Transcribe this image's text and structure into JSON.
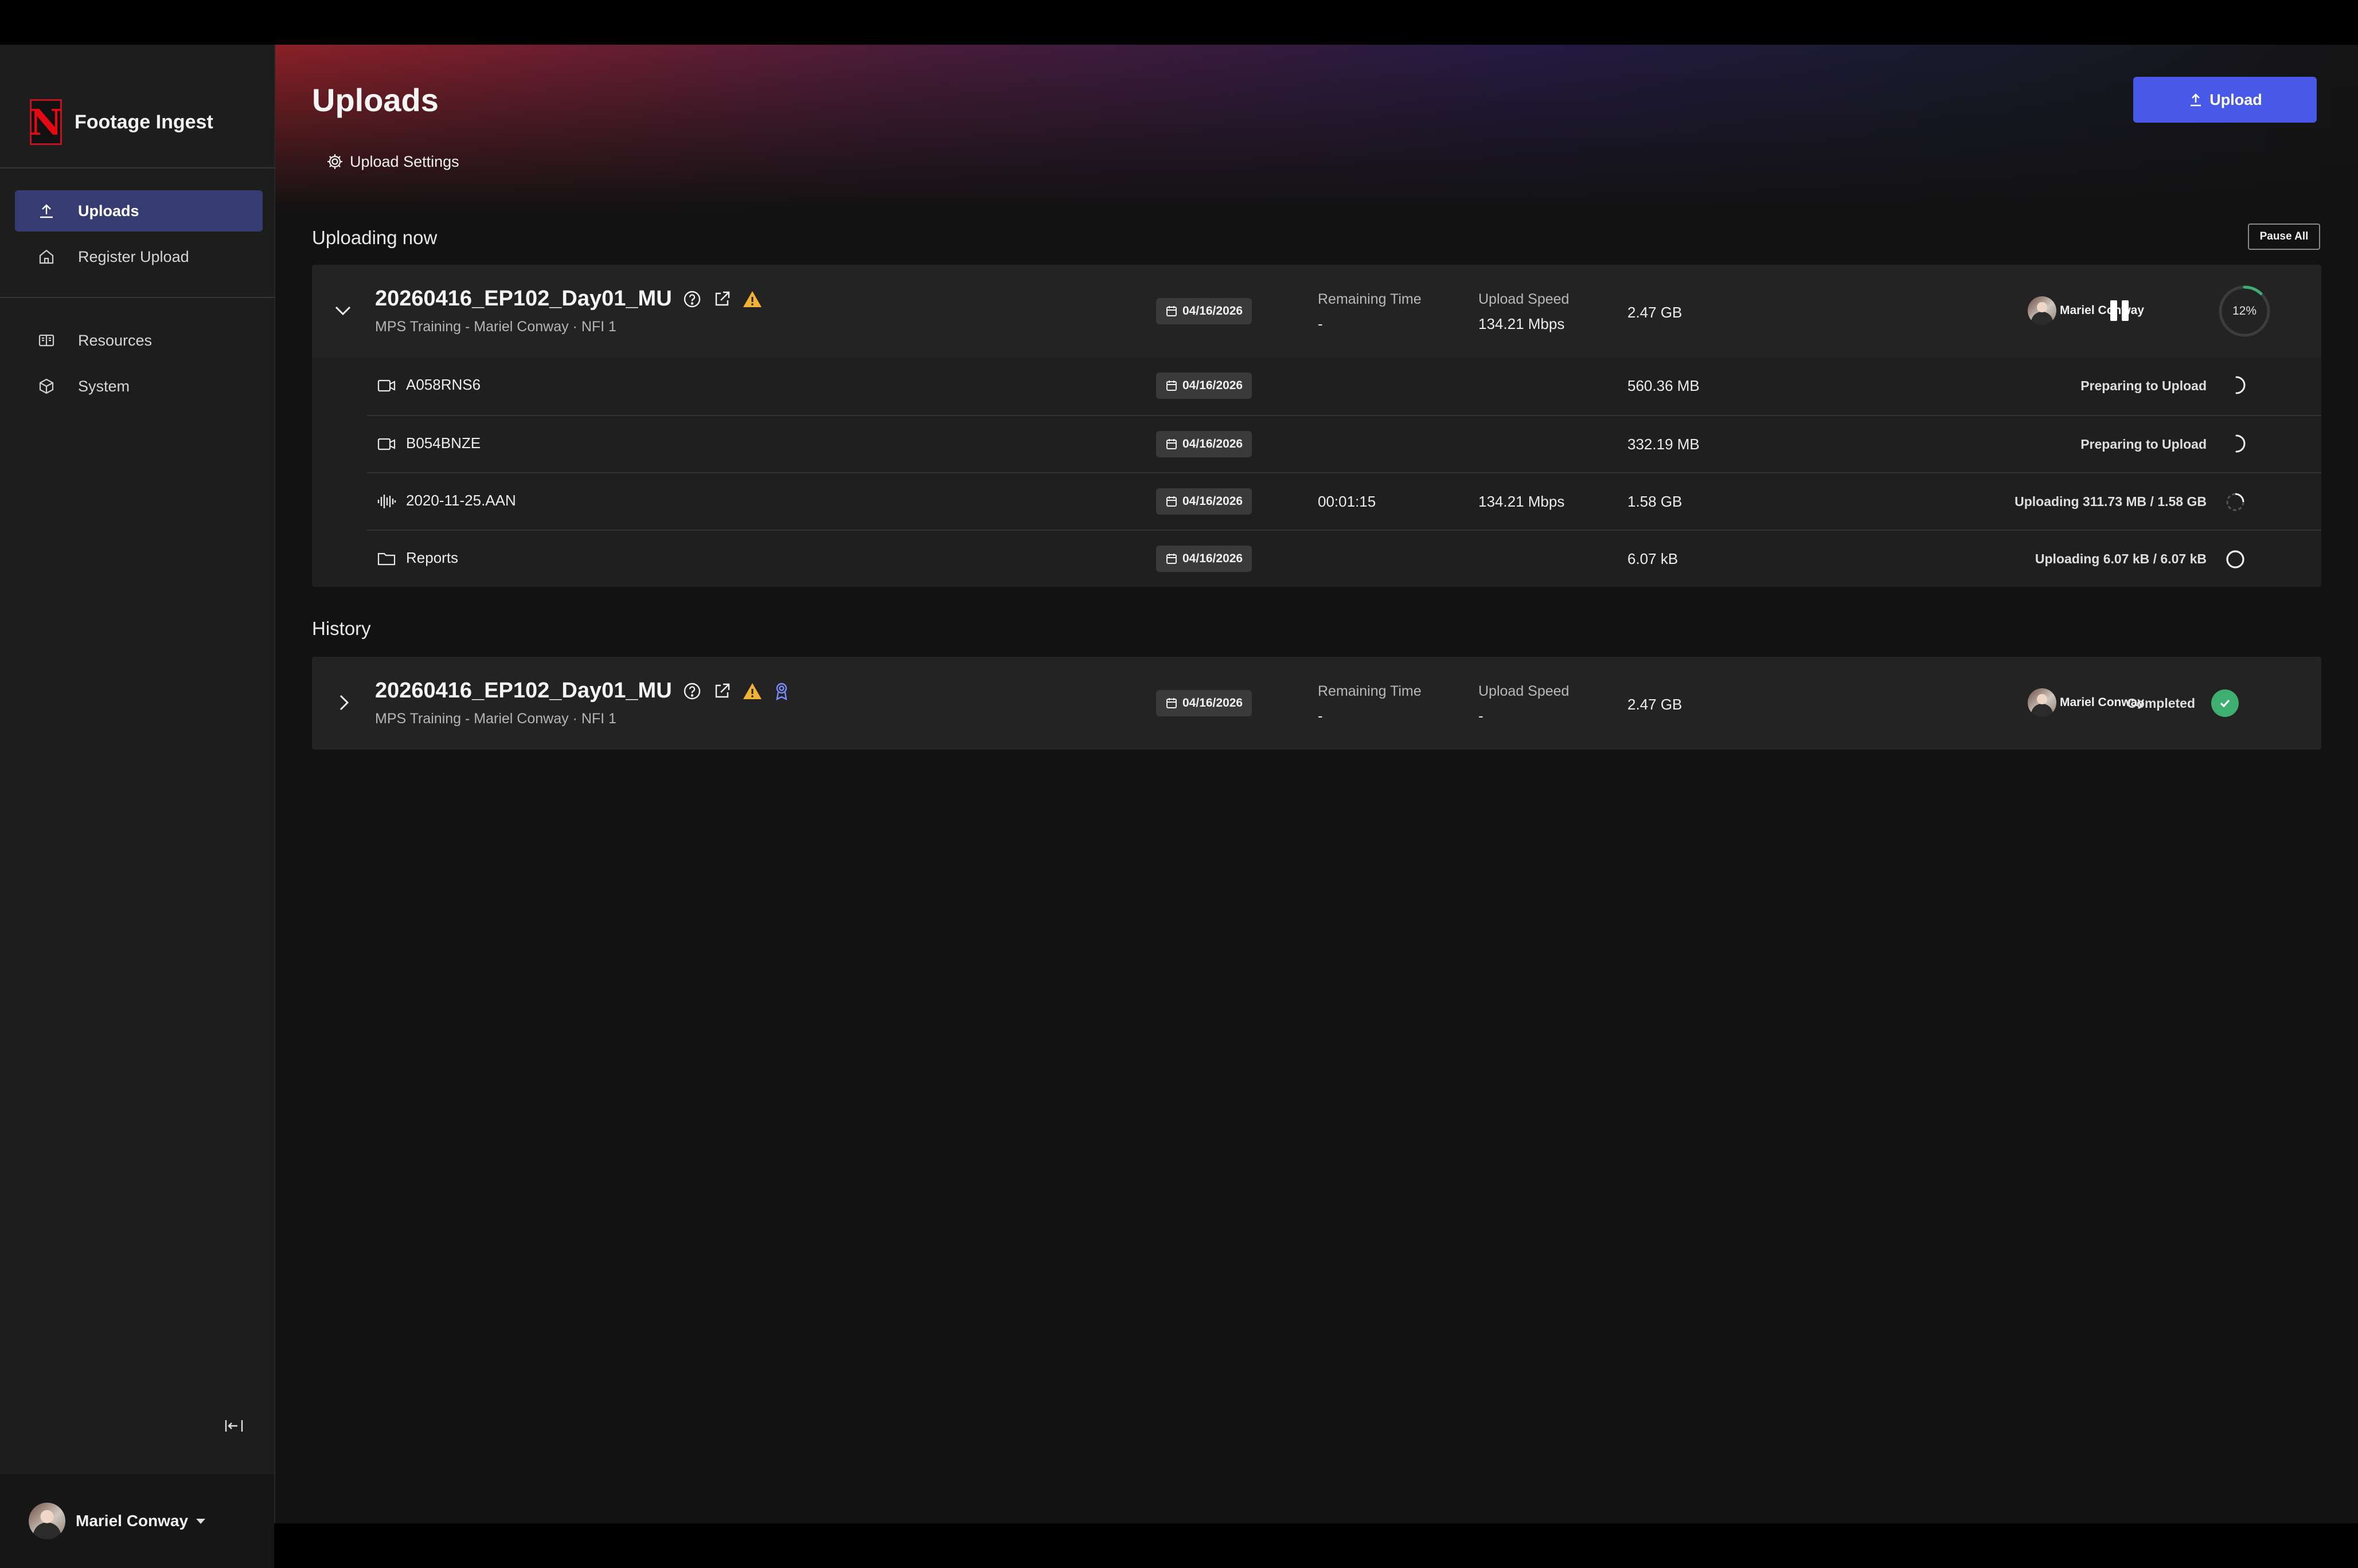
{
  "app": {
    "title": "Footage Ingest"
  },
  "sidebar": {
    "nav": [
      {
        "label": "Uploads",
        "icon": "upload-icon",
        "active": true
      },
      {
        "label": "Register Upload",
        "icon": "home-icon",
        "active": false
      }
    ],
    "nav2": [
      {
        "label": "Resources",
        "icon": "book-icon"
      },
      {
        "label": "System",
        "icon": "cube-icon"
      }
    ],
    "user": {
      "name": "Mariel Conway"
    }
  },
  "header": {
    "title": "Uploads",
    "upload_button": "Upload",
    "settings_link": "Upload Settings"
  },
  "uploading": {
    "section_title": "Uploading now",
    "pause_all": "Pause All",
    "group": {
      "name": "20260416_EP102_Day01_MU",
      "subtitle": "MPS Training - Mariel Conway · NFI 1",
      "date": "04/16/2026",
      "remaining_label": "Remaining Time",
      "remaining_value": "-",
      "speed_label": "Upload Speed",
      "speed_value": "134.21 Mbps",
      "size": "2.47 GB",
      "owner": "Mariel Conway",
      "progress_percent": 12,
      "progress_text": "12%"
    },
    "files": [
      {
        "name": "A058RNS6",
        "icon": "video-camera-icon",
        "date": "04/16/2026",
        "remaining": "",
        "speed": "",
        "size": "560.36 MB",
        "status": "Preparing to Upload",
        "state": "preparing"
      },
      {
        "name": "B054BNZE",
        "icon": "video-camera-icon",
        "date": "04/16/2026",
        "remaining": "",
        "speed": "",
        "size": "332.19 MB",
        "status": "Preparing to Upload",
        "state": "preparing"
      },
      {
        "name": "2020-11-25.AAN",
        "icon": "audio-waveform-icon",
        "date": "04/16/2026",
        "remaining": "00:01:15",
        "speed": "134.21 Mbps",
        "size": "1.58 GB",
        "status": "Uploading 311.73 MB / 1.58 GB",
        "state": "uploading"
      },
      {
        "name": "Reports",
        "icon": "folder-icon",
        "date": "04/16/2026",
        "remaining": "",
        "speed": "",
        "size": "6.07 kB",
        "status": "Uploading 6.07 kB / 6.07 kB",
        "state": "done-ring"
      }
    ]
  },
  "history": {
    "section_title": "History",
    "group": {
      "name": "20260416_EP102_Day01_MU",
      "subtitle": "MPS Training - Mariel Conway · NFI 1",
      "date": "04/16/2026",
      "remaining_label": "Remaining Time",
      "remaining_value": "-",
      "speed_label": "Upload Speed",
      "speed_value": "-",
      "size": "2.47 GB",
      "owner": "Mariel Conway",
      "status": "Completed"
    }
  },
  "colors": {
    "accent": "#4759e6",
    "nav_active": "#363c72",
    "success": "#3fae71",
    "warning": "#f2b233",
    "badge_blue": "#7b8cff"
  }
}
